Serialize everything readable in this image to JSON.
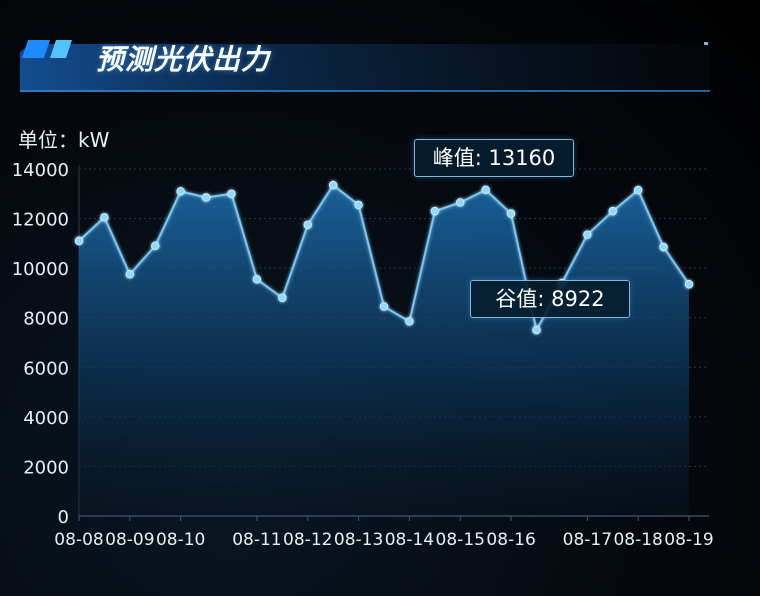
{
  "panel": {
    "title": "预测光伏出力",
    "unit_label": "单位：kW"
  },
  "colors": {
    "accent": "#2aa8ff",
    "line": "#7cc6f0",
    "point": "#8fd9ff",
    "grid": "#2b3b4a",
    "axis_text": "#e6eef6"
  },
  "annotations": {
    "peak_label": "峰值:",
    "peak_value": "13160",
    "valley_label": "谷值:",
    "valley_value": "8922"
  },
  "chart_data": {
    "type": "area",
    "x_tick_labels": [
      "08-08",
      "08-09",
      "08-10",
      "08-11",
      "08-12",
      "08-13",
      "08-14",
      "08-15",
      "08-16",
      "08-17",
      "08-18",
      "08-19"
    ],
    "ylim": [
      0,
      14000
    ],
    "y_ticks": [
      0,
      2000,
      4000,
      6000,
      8000,
      10000,
      12000,
      14000
    ],
    "grid": true,
    "series": [
      {
        "values": [
          11100,
          12050,
          9750,
          10900,
          13100,
          12850,
          13000,
          9550,
          8800,
          11750,
          13350,
          12550,
          8450,
          7850,
          12300,
          12650,
          13160,
          12200,
          7500,
          9400,
          11350,
          12300,
          13150,
          10850,
          9350
        ]
      }
    ]
  }
}
